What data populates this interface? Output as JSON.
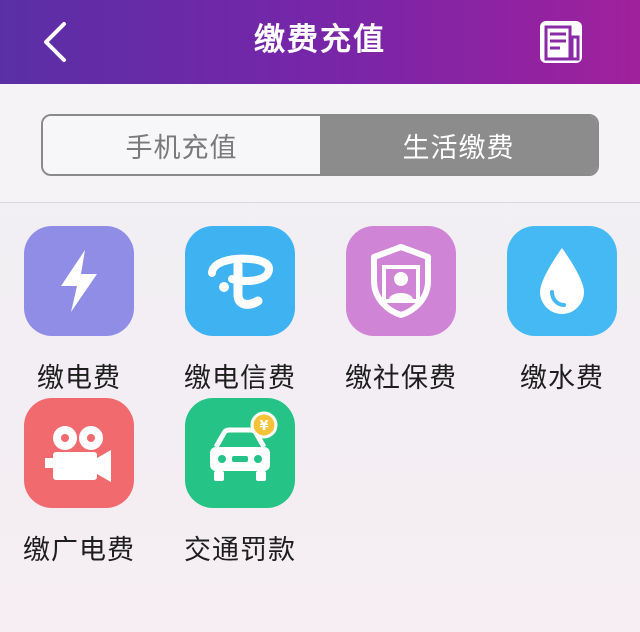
{
  "header": {
    "title": "缴费充值",
    "back_icon": "chevron-left-icon",
    "records_icon": "receipt-icon"
  },
  "tabs": [
    {
      "label": "手机充值",
      "selected": false
    },
    {
      "label": "生活缴费",
      "selected": true
    }
  ],
  "services": [
    {
      "label": "缴电费",
      "icon": "lightning-icon",
      "color": "#8f8de6"
    },
    {
      "label": "缴电信费",
      "icon": "telecom-icon",
      "color": "#3fb3f2"
    },
    {
      "label": "缴社保费",
      "icon": "shield-person-icon",
      "color": "#cf84d6"
    },
    {
      "label": "缴水费",
      "icon": "water-drop-icon",
      "color": "#45b9f3"
    },
    {
      "label": "缴广电费",
      "icon": "film-camera-icon",
      "color": "#f06a6e"
    },
    {
      "label": "交通罚款",
      "icon": "car-yen-icon",
      "color": "#25c486"
    }
  ]
}
